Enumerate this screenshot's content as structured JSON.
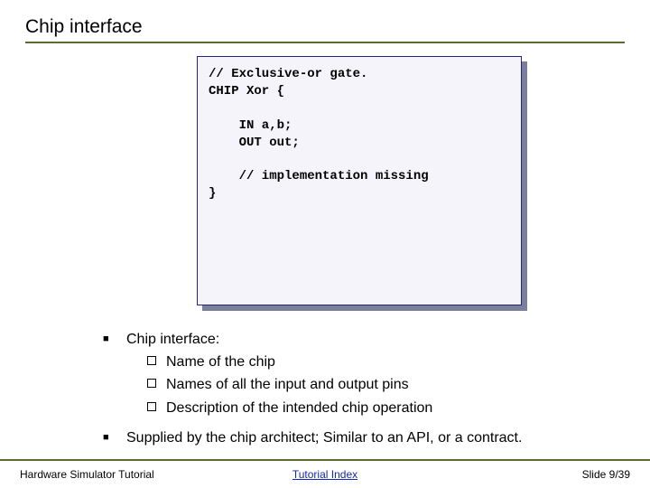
{
  "title": "Chip interface",
  "code": {
    "l1": "// Exclusive-or gate.",
    "l2": "CHIP Xor {",
    "l3": "    IN a,b;",
    "l4": "    OUT out;",
    "l5": "    // implementation missing",
    "l6": "}"
  },
  "bullets": {
    "b1": {
      "lead": "Chip interface:",
      "sub1": "Name of the chip",
      "sub2": "Names of all the input and output pins",
      "sub3": "Description of the intended chip operation"
    },
    "b2": {
      "text": "Supplied by the chip architect;  Similar to an API, or a contract."
    }
  },
  "footer": {
    "left": "Hardware Simulator Tutorial",
    "center": "Tutorial Index",
    "right": "Slide 9/39"
  }
}
